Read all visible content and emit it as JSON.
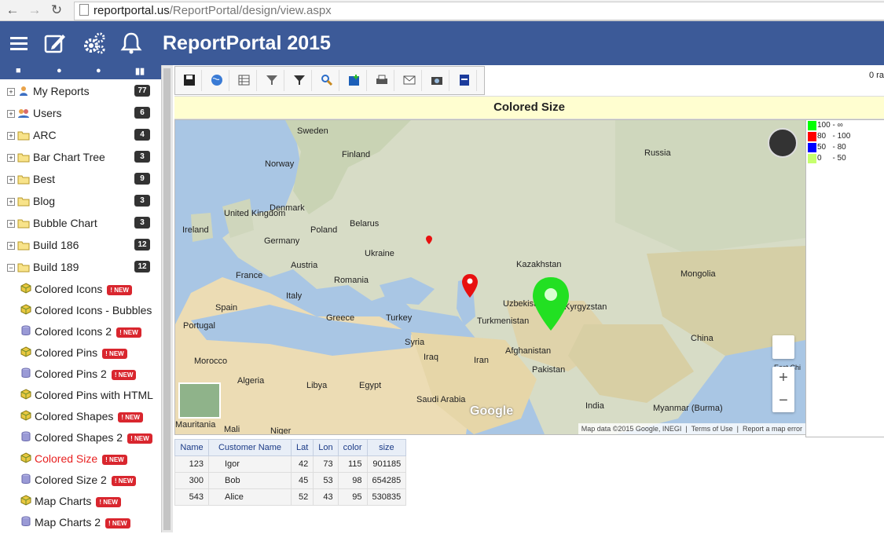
{
  "browser": {
    "url_domain": "reportportal.us",
    "url_path": "/ReportPortal/design/view.aspx"
  },
  "header": {
    "title": "ReportPortal 2015",
    "icons": [
      "menu-icon",
      "edit-icon",
      "settings-icon",
      "bell-icon"
    ]
  },
  "sidebar": {
    "strip_icons": [
      "folder-icon",
      "plus-icon",
      "minus-icon",
      "binoculars-icon"
    ],
    "folders": [
      {
        "label": "My Reports",
        "count": "77",
        "icon": "user-icon"
      },
      {
        "label": "Users",
        "count": "6",
        "icon": "users-icon"
      },
      {
        "label": "ARC",
        "count": "4",
        "icon": "folder-icon"
      },
      {
        "label": "Bar Chart Tree",
        "count": "3",
        "icon": "folder-icon"
      },
      {
        "label": "Best",
        "count": "9",
        "icon": "folder-icon"
      },
      {
        "label": "Blog",
        "count": "3",
        "icon": "folder-icon"
      },
      {
        "label": "Bubble Chart",
        "count": "3",
        "icon": "folder-icon"
      },
      {
        "label": "Build 186",
        "count": "12",
        "icon": "folder-icon"
      },
      {
        "label": "Build 189",
        "count": "12",
        "icon": "folder-open-icon"
      }
    ],
    "children": [
      {
        "label": "Colored Icons",
        "badge": "! NEW",
        "icon": "cube-icon"
      },
      {
        "label": "Colored Icons - Bubbles",
        "badge": "",
        "icon": "cube-icon"
      },
      {
        "label": "Colored Icons 2",
        "badge": "! NEW",
        "icon": "database-icon"
      },
      {
        "label": "Colored Pins",
        "badge": "! NEW",
        "icon": "cube-icon"
      },
      {
        "label": "Colored Pins 2",
        "badge": "! NEW",
        "icon": "database-icon"
      },
      {
        "label": "Colored Pins with HTML",
        "badge": "",
        "icon": "cube-icon"
      },
      {
        "label": "Colored Shapes",
        "badge": "! NEW",
        "icon": "cube-icon"
      },
      {
        "label": "Colored Shapes 2",
        "badge": "! NEW",
        "icon": "database-icon"
      },
      {
        "label": "Colored Size",
        "badge": "! NEW",
        "icon": "cube-icon",
        "active": true
      },
      {
        "label": "Colored Size 2",
        "badge": "! NEW",
        "icon": "database-icon"
      },
      {
        "label": "Map Charts",
        "badge": "! NEW",
        "icon": "cube-icon"
      },
      {
        "label": "Map Charts 2",
        "badge": "! NEW",
        "icon": "database-icon"
      }
    ]
  },
  "toolbar": {
    "buttons": [
      "save-icon",
      "globe-icon",
      "table-edit-icon",
      "filter-icon",
      "filter-edit-icon",
      "search-icon",
      "save-as-icon",
      "print-icon",
      "email-icon",
      "camera-icon",
      "document-icon"
    ],
    "rows_text": "0 ra"
  },
  "report": {
    "title": "Colored Size"
  },
  "map": {
    "labels": [
      {
        "text": "Sweden",
        "key": "sweden"
      },
      {
        "text": "Finland",
        "key": "finland"
      },
      {
        "text": "Norway",
        "key": "norway"
      },
      {
        "text": "Russia",
        "key": "russia"
      },
      {
        "text": "Denmark",
        "key": "denmark"
      },
      {
        "text": "United Kingdom",
        "key": "uk"
      },
      {
        "text": "Ireland",
        "key": "ireland"
      },
      {
        "text": "Belarus",
        "key": "belarus"
      },
      {
        "text": "Poland",
        "key": "poland"
      },
      {
        "text": "Germany",
        "key": "germany"
      },
      {
        "text": "Ukraine",
        "key": "ukraine"
      },
      {
        "text": "Kazakhstan",
        "key": "kazakhstan"
      },
      {
        "text": "France",
        "key": "france"
      },
      {
        "text": "Austria",
        "key": "austria"
      },
      {
        "text": "Romania",
        "key": "romania"
      },
      {
        "text": "Mongolia",
        "key": "mongolia"
      },
      {
        "text": "Italy",
        "key": "italy"
      },
      {
        "text": "Spain",
        "key": "spain"
      },
      {
        "text": "Uzbekistan",
        "key": "uzbekistan"
      },
      {
        "text": "Kyrgyzstan",
        "key": "kyrgyzstan"
      },
      {
        "text": "Portugal",
        "key": "portugal"
      },
      {
        "text": "Greece",
        "key": "greece"
      },
      {
        "text": "Turkey",
        "key": "turkey"
      },
      {
        "text": "Turkmenistan",
        "key": "turkmenistan"
      },
      {
        "text": "Syria",
        "key": "syria"
      },
      {
        "text": "Afghanistan",
        "key": "afghanistan"
      },
      {
        "text": "China",
        "key": "china"
      },
      {
        "text": "Iraq",
        "key": "iraq"
      },
      {
        "text": "Iran",
        "key": "iran"
      },
      {
        "text": "Morocco",
        "key": "morocco"
      },
      {
        "text": "Pakistan",
        "key": "pakistan"
      },
      {
        "text": "Algeria",
        "key": "algeria"
      },
      {
        "text": "Libya",
        "key": "libya"
      },
      {
        "text": "Egypt",
        "key": "egypt"
      },
      {
        "text": "Saudi Arabia",
        "key": "saudi"
      },
      {
        "text": "India",
        "key": "india"
      },
      {
        "text": "Myanmar (Burma)",
        "key": "myanmar"
      },
      {
        "text": "Mauritania",
        "key": "mauritania"
      },
      {
        "text": "Mali",
        "key": "mali"
      },
      {
        "text": "Niger",
        "key": "niger"
      },
      {
        "text": "East Chi",
        "key": "eastchina"
      }
    ],
    "google": "Google",
    "footer_data": "Map data ©2015 Google, INEGI",
    "footer_terms": "Terms of Use",
    "footer_report": "Report a map error",
    "zoom_in": "+",
    "zoom_out": "−",
    "markers": [
      {
        "name": "Igor",
        "color": "#1ee01e"
      },
      {
        "name": "Bob",
        "color": "#e81010"
      },
      {
        "name": "Alice",
        "color": "#e81010"
      }
    ]
  },
  "legend": [
    {
      "text": "100 - ∞",
      "color": "#00ff00"
    },
    {
      "text": "80   - 100",
      "color": "#ff0000"
    },
    {
      "text": "50   - 80",
      "color": "#0000ff"
    },
    {
      "text": "0     - 50",
      "color": "#c6ff6e"
    }
  ],
  "table": {
    "columns": [
      "Name",
      "Customer Name",
      "Lat",
      "Lon",
      "color",
      "size"
    ],
    "rows": [
      [
        "123",
        "Igor",
        "42",
        "73",
        "115",
        "901185"
      ],
      [
        "300",
        "Bob",
        "45",
        "53",
        "98",
        "654285"
      ],
      [
        "543",
        "Alice",
        "52",
        "43",
        "95",
        "530835"
      ]
    ]
  }
}
